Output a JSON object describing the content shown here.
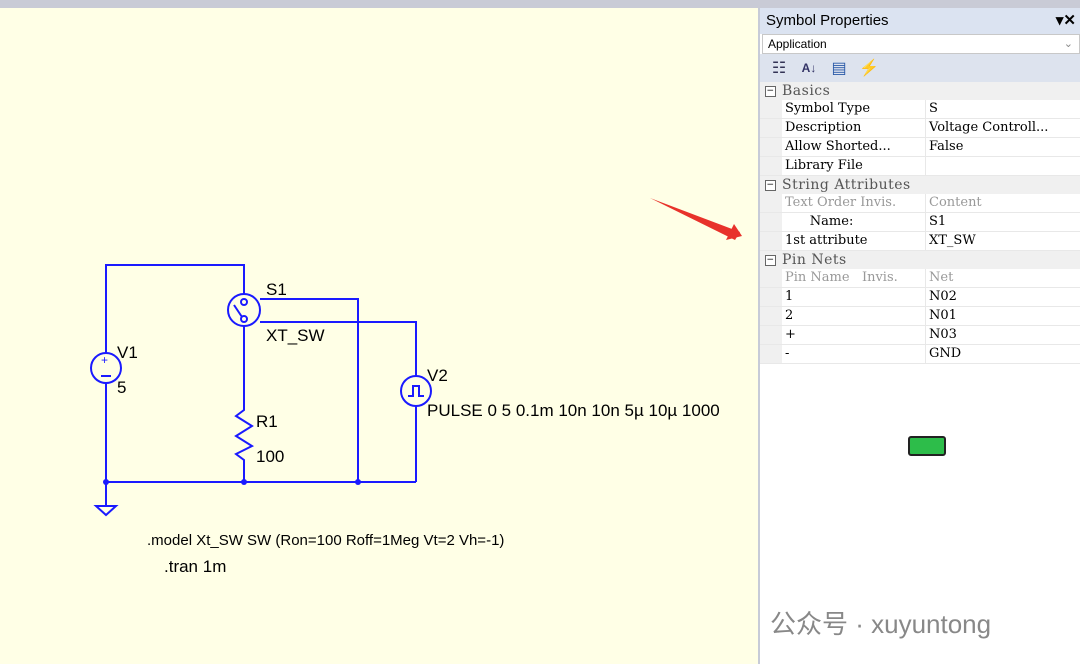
{
  "schematic": {
    "v1": {
      "name": "V1",
      "value": "5"
    },
    "s1": {
      "name": "S1",
      "model": "XT_SW"
    },
    "r1": {
      "name": "R1",
      "value": "100"
    },
    "v2": {
      "name": "V2",
      "value": "PULSE 0 5 0.1m 10n 10n 5µ 10µ 1000"
    },
    "directives": [
      ".model Xt_SW SW (Ron=100 Roff=1Meg Vt=2 Vh=-1)",
      ".tran 1m"
    ],
    "wire_color": "#1a1aff"
  },
  "panel": {
    "title": "Symbol Properties",
    "controls": "▾✕",
    "combo": "Application",
    "combo_chevron": "⌄",
    "toolbar": [
      "categorized-icon",
      "sort-az-icon",
      "property-pages-icon",
      "events-icon"
    ],
    "sections": [
      {
        "label": "Basics",
        "toggle": "−",
        "rows": [
          [
            "Symbol Type",
            "S"
          ],
          [
            "Description",
            "Voltage Controll..."
          ],
          [
            "Allow Shorted...",
            "False"
          ],
          [
            "Library File",
            ""
          ]
        ]
      },
      {
        "label": "String Attributes",
        "toggle": "−",
        "header": [
          "Text Order Invis.",
          "Content"
        ],
        "rows": [
          [
            "      Name:",
            "S1"
          ],
          [
            "1st attribute",
            "XT_SW"
          ]
        ]
      },
      {
        "label": "Pin Nets",
        "toggle": "−",
        "header": [
          "Pin Name   Invis.",
          "Net"
        ],
        "rows": [
          [
            "1",
            "N02"
          ],
          [
            "2",
            "N01"
          ],
          [
            "+",
            "N03"
          ],
          [
            "-",
            "GND"
          ]
        ]
      }
    ]
  },
  "watermark": "公众号 · xuyuntong",
  "annotation_arrow_color": "#e8322b"
}
